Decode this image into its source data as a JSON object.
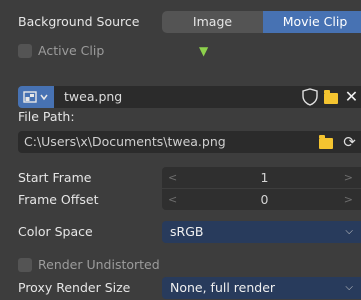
{
  "background_source": {
    "label": "Background Source",
    "options": [
      "Image",
      "Movie Clip"
    ],
    "selected": "Movie Clip"
  },
  "active_clip": {
    "label": "Active Clip",
    "checked": false
  },
  "image": {
    "name": "twea.png",
    "file_path_label": "File Path:",
    "file_path": "C:\\Users\\x\\Documents\\twea.png"
  },
  "start_frame": {
    "label": "Start Frame",
    "value": "1"
  },
  "frame_offset": {
    "label": "Frame Offset",
    "value": "0"
  },
  "color_space": {
    "label": "Color Space",
    "value": "sRGB"
  },
  "render_undistorted": {
    "label": "Render Undistorted",
    "checked": false
  },
  "proxy_render_size": {
    "label": "Proxy Render Size",
    "value": "None, full render"
  },
  "colors": {
    "panel_bg": "#3d3d3d",
    "accent": "#4772b3",
    "field_bg": "#2b2b2b",
    "dropdown_bg": "#283b5c",
    "folder": "#f4c430",
    "indicator": "#8dd14c"
  },
  "icons": {
    "dropdown_marker": "triangle-down-icon",
    "image_browse": "image-browse-icon",
    "fake_user": "shield-icon",
    "open_folder": "folder-icon",
    "unlink": "close-icon",
    "reload": "reload-icon"
  }
}
